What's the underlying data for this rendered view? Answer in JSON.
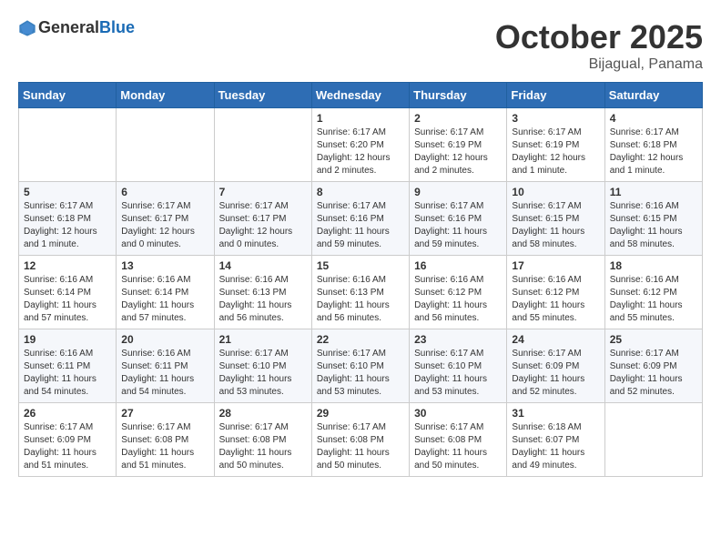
{
  "header": {
    "logo_general": "General",
    "logo_blue": "Blue",
    "month": "October 2025",
    "location": "Bijagual, Panama"
  },
  "days_of_week": [
    "Sunday",
    "Monday",
    "Tuesday",
    "Wednesday",
    "Thursday",
    "Friday",
    "Saturday"
  ],
  "weeks": [
    [
      {
        "day": "",
        "info": ""
      },
      {
        "day": "",
        "info": ""
      },
      {
        "day": "",
        "info": ""
      },
      {
        "day": "1",
        "info": "Sunrise: 6:17 AM\nSunset: 6:20 PM\nDaylight: 12 hours\nand 2 minutes."
      },
      {
        "day": "2",
        "info": "Sunrise: 6:17 AM\nSunset: 6:19 PM\nDaylight: 12 hours\nand 2 minutes."
      },
      {
        "day": "3",
        "info": "Sunrise: 6:17 AM\nSunset: 6:19 PM\nDaylight: 12 hours\nand 1 minute."
      },
      {
        "day": "4",
        "info": "Sunrise: 6:17 AM\nSunset: 6:18 PM\nDaylight: 12 hours\nand 1 minute."
      }
    ],
    [
      {
        "day": "5",
        "info": "Sunrise: 6:17 AM\nSunset: 6:18 PM\nDaylight: 12 hours\nand 1 minute."
      },
      {
        "day": "6",
        "info": "Sunrise: 6:17 AM\nSunset: 6:17 PM\nDaylight: 12 hours\nand 0 minutes."
      },
      {
        "day": "7",
        "info": "Sunrise: 6:17 AM\nSunset: 6:17 PM\nDaylight: 12 hours\nand 0 minutes."
      },
      {
        "day": "8",
        "info": "Sunrise: 6:17 AM\nSunset: 6:16 PM\nDaylight: 11 hours\nand 59 minutes."
      },
      {
        "day": "9",
        "info": "Sunrise: 6:17 AM\nSunset: 6:16 PM\nDaylight: 11 hours\nand 59 minutes."
      },
      {
        "day": "10",
        "info": "Sunrise: 6:17 AM\nSunset: 6:15 PM\nDaylight: 11 hours\nand 58 minutes."
      },
      {
        "day": "11",
        "info": "Sunrise: 6:16 AM\nSunset: 6:15 PM\nDaylight: 11 hours\nand 58 minutes."
      }
    ],
    [
      {
        "day": "12",
        "info": "Sunrise: 6:16 AM\nSunset: 6:14 PM\nDaylight: 11 hours\nand 57 minutes."
      },
      {
        "day": "13",
        "info": "Sunrise: 6:16 AM\nSunset: 6:14 PM\nDaylight: 11 hours\nand 57 minutes."
      },
      {
        "day": "14",
        "info": "Sunrise: 6:16 AM\nSunset: 6:13 PM\nDaylight: 11 hours\nand 56 minutes."
      },
      {
        "day": "15",
        "info": "Sunrise: 6:16 AM\nSunset: 6:13 PM\nDaylight: 11 hours\nand 56 minutes."
      },
      {
        "day": "16",
        "info": "Sunrise: 6:16 AM\nSunset: 6:12 PM\nDaylight: 11 hours\nand 56 minutes."
      },
      {
        "day": "17",
        "info": "Sunrise: 6:16 AM\nSunset: 6:12 PM\nDaylight: 11 hours\nand 55 minutes."
      },
      {
        "day": "18",
        "info": "Sunrise: 6:16 AM\nSunset: 6:12 PM\nDaylight: 11 hours\nand 55 minutes."
      }
    ],
    [
      {
        "day": "19",
        "info": "Sunrise: 6:16 AM\nSunset: 6:11 PM\nDaylight: 11 hours\nand 54 minutes."
      },
      {
        "day": "20",
        "info": "Sunrise: 6:16 AM\nSunset: 6:11 PM\nDaylight: 11 hours\nand 54 minutes."
      },
      {
        "day": "21",
        "info": "Sunrise: 6:17 AM\nSunset: 6:10 PM\nDaylight: 11 hours\nand 53 minutes."
      },
      {
        "day": "22",
        "info": "Sunrise: 6:17 AM\nSunset: 6:10 PM\nDaylight: 11 hours\nand 53 minutes."
      },
      {
        "day": "23",
        "info": "Sunrise: 6:17 AM\nSunset: 6:10 PM\nDaylight: 11 hours\nand 53 minutes."
      },
      {
        "day": "24",
        "info": "Sunrise: 6:17 AM\nSunset: 6:09 PM\nDaylight: 11 hours\nand 52 minutes."
      },
      {
        "day": "25",
        "info": "Sunrise: 6:17 AM\nSunset: 6:09 PM\nDaylight: 11 hours\nand 52 minutes."
      }
    ],
    [
      {
        "day": "26",
        "info": "Sunrise: 6:17 AM\nSunset: 6:09 PM\nDaylight: 11 hours\nand 51 minutes."
      },
      {
        "day": "27",
        "info": "Sunrise: 6:17 AM\nSunset: 6:08 PM\nDaylight: 11 hours\nand 51 minutes."
      },
      {
        "day": "28",
        "info": "Sunrise: 6:17 AM\nSunset: 6:08 PM\nDaylight: 11 hours\nand 50 minutes."
      },
      {
        "day": "29",
        "info": "Sunrise: 6:17 AM\nSunset: 6:08 PM\nDaylight: 11 hours\nand 50 minutes."
      },
      {
        "day": "30",
        "info": "Sunrise: 6:17 AM\nSunset: 6:08 PM\nDaylight: 11 hours\nand 50 minutes."
      },
      {
        "day": "31",
        "info": "Sunrise: 6:18 AM\nSunset: 6:07 PM\nDaylight: 11 hours\nand 49 minutes."
      },
      {
        "day": "",
        "info": ""
      }
    ]
  ]
}
